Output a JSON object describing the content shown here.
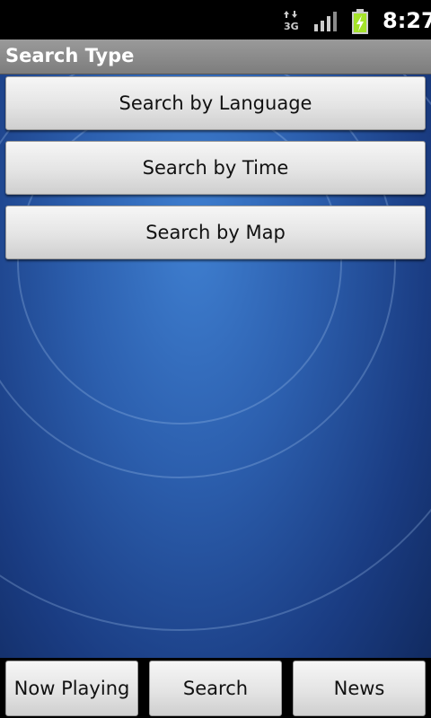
{
  "status_bar": {
    "network_icon": "3g-data-icon",
    "network_label": "3G",
    "signal_icon": "signal-strength-icon",
    "battery_icon": "battery-charging-icon",
    "time": "8:27"
  },
  "title_bar": {
    "title": "Search Type"
  },
  "main": {
    "buttons": [
      {
        "label": "Search by Language"
      },
      {
        "label": "Search by Time"
      },
      {
        "label": "Search by Map"
      }
    ]
  },
  "bottom_nav": {
    "tabs": [
      {
        "label": "Now Playing"
      },
      {
        "label": "Search"
      },
      {
        "label": "News"
      }
    ]
  },
  "colors": {
    "title_bar_bg": "#8a8a8a",
    "wallpaper_primary": "#2c5fae",
    "battery_accent": "#a4e22a"
  }
}
